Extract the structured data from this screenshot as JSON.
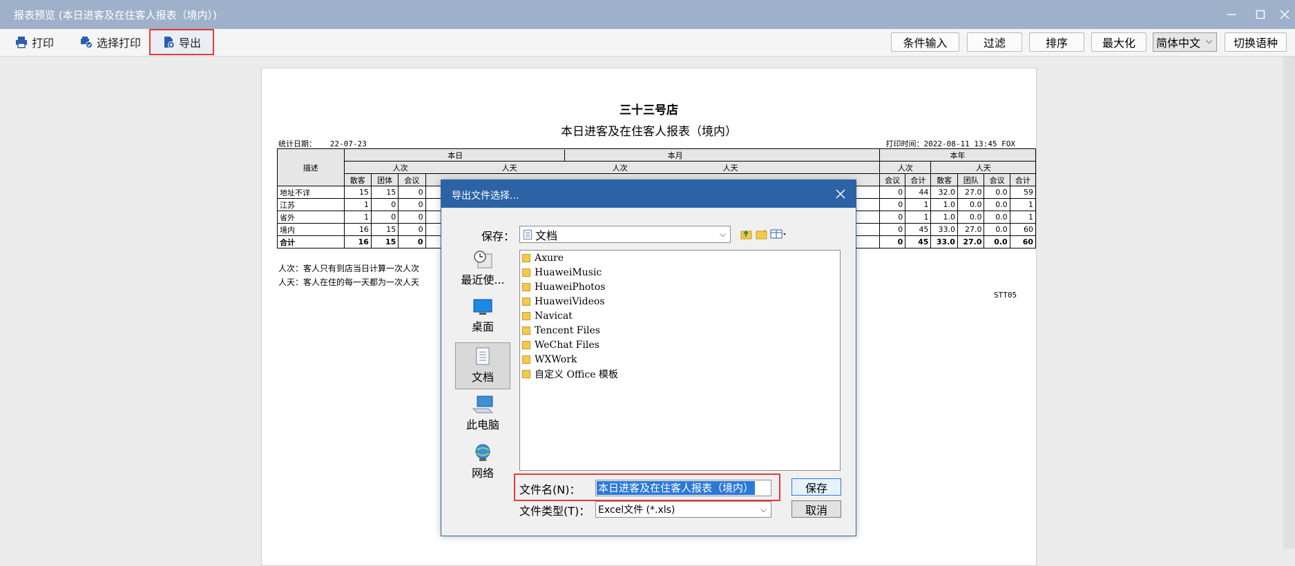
{
  "window": {
    "title": "报表预览 (本日进客及在住客人报表（境内）)"
  },
  "toolbar": {
    "print": "打印",
    "select_print": "选择打印",
    "export": "导出",
    "condition_input": "条件输入",
    "filter": "过滤",
    "sort": "排序",
    "maximize": "最大化",
    "language": "简体中文",
    "switch_language": "切换语种"
  },
  "report": {
    "shop": "三十三号店",
    "title": "本日进客及在住客人报表（境内）",
    "stat_date_label": "统计日期：",
    "stat_date": "22-07-23",
    "print_time": "打印时间：2022-08-11 13:45 FOX",
    "desc_header": "描述",
    "period_today": "本日",
    "period_month": "本月",
    "period_year": "本年",
    "visits": "人次",
    "nights": "人天",
    "sub_left": [
      "散客",
      "团体",
      "会议"
    ],
    "sub_right": [
      "会议",
      "合计",
      "散客",
      "团队",
      "会议",
      "合计"
    ],
    "rows": [
      {
        "name": "地址不详",
        "left": [
          "15",
          "15",
          "0"
        ],
        "right": [
          "0",
          "44",
          "32.0",
          "27.0",
          "0.0",
          "59"
        ]
      },
      {
        "name": "江苏",
        "left": [
          "1",
          "0",
          "0"
        ],
        "right": [
          "0",
          "1",
          "1.0",
          "0.0",
          "0.0",
          "1"
        ]
      },
      {
        "name": "省外",
        "left": [
          "1",
          "0",
          "0"
        ],
        "right": [
          "0",
          "1",
          "1.0",
          "0.0",
          "0.0",
          "1"
        ]
      },
      {
        "name": "境内",
        "left": [
          "16",
          "15",
          "0"
        ],
        "right": [
          "0",
          "45",
          "33.0",
          "27.0",
          "0.0",
          "60"
        ]
      },
      {
        "name": "合计",
        "left": [
          "16",
          "15",
          "0"
        ],
        "right": [
          "0",
          "45",
          "33.0",
          "27.0",
          "0.0",
          "60"
        ]
      }
    ],
    "note1": "人次：客人只有到店当日计算一次人次",
    "note2": "人天：客人在住的每一天都为一次人天",
    "code": "STT05"
  },
  "dialog": {
    "title": "导出文件选择...",
    "save_in_label": "保存：",
    "save_in_value": "文档",
    "places": [
      "最近使...",
      "桌面",
      "文档",
      "此电脑",
      "网络"
    ],
    "files": [
      "Axure",
      "HuaweiMusic",
      "HuaweiPhotos",
      "HuaweiVideos",
      "Navicat",
      "Tencent Files",
      "WeChat Files",
      "WXWork",
      "自定义 Office 模板"
    ],
    "filename_label": "文件名(N)：",
    "filename_value": "本日进客及在住客人报表（境内）",
    "filetype_label": "文件类型(T)：",
    "filetype_value": "Excel文件 (*.xls)",
    "save_button": "保存",
    "cancel_button": "取消"
  },
  "colors": {
    "titlebar": "#9fb1ca",
    "dialog_title": "#2b63a6",
    "highlight_outline": "#e53935",
    "selection": "#2b79d7"
  }
}
